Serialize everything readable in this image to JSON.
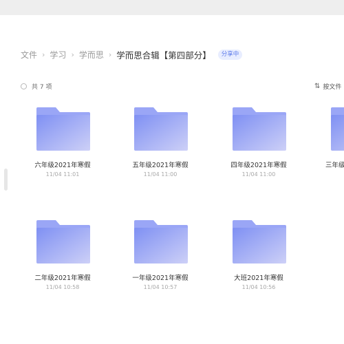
{
  "breadcrumb": {
    "items": [
      "文件",
      "学习",
      "学而思"
    ],
    "current": "学而思合辑【第四部分】",
    "separator": "›",
    "badge": "分享中"
  },
  "list_header": {
    "count_text": "共 7 项",
    "sort_icon": "sort-arrows-icon",
    "sort_label": "按文件"
  },
  "colors": {
    "accent": "#5a79ea",
    "folder_back": "#9aa6f6",
    "folder_front_start": "#7f90f3",
    "folder_front_end": "#cdd0f7"
  },
  "folders": [
    {
      "name": "六年级2021年寒假",
      "time": "11/04 11:01"
    },
    {
      "name": "五年级2021年寒假",
      "time": "11/04 11:00"
    },
    {
      "name": "四年级2021年寒假",
      "time": "11/04 11:00"
    },
    {
      "name": "三年级",
      "time": ""
    },
    {
      "name": "二年级2021年寒假",
      "time": "11/04 10:58"
    },
    {
      "name": "一年级2021年寒假",
      "time": "11/04 10:57"
    },
    {
      "name": "大班2021年寒假",
      "time": "11/04 10:56"
    }
  ]
}
